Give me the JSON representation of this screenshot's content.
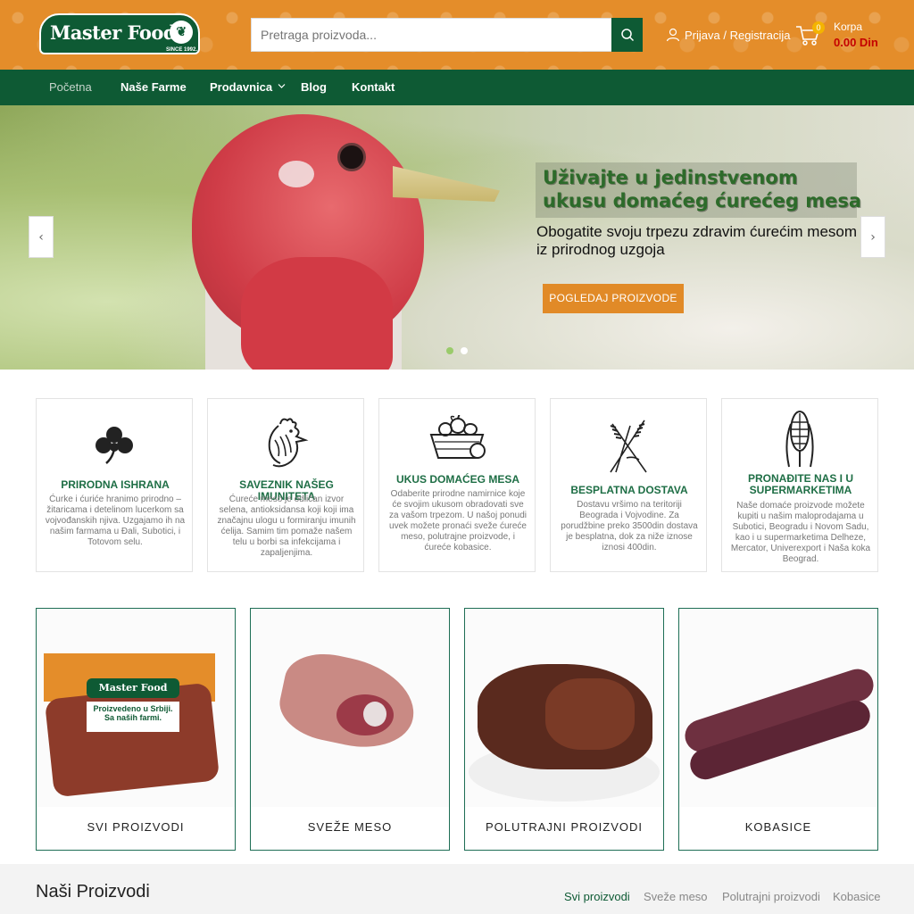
{
  "header": {
    "logo_text": "Master Food",
    "logo_tagline": "SINCE 1992.",
    "search_placeholder": "Pretraga proizvoda...",
    "account_label": "Prijava / Registracija",
    "cart_label": "Korpa",
    "cart_count": "0",
    "cart_total": "0.00 Din"
  },
  "nav": {
    "items": [
      "Početna",
      "Naše Farme",
      "Prodavnica",
      "Blog",
      "Kontakt"
    ]
  },
  "hero": {
    "title": "Uživajte u jedinstvenom ukusu domaćeg ćurećeg mesa",
    "subtitle": "Obogatite svoju trpezu zdravim ćurećim mesom iz prirodnog uzgoja",
    "cta": "POGLEDAJ PROIZVODE",
    "active_slide": 2,
    "slide_count": 2
  },
  "features": [
    {
      "icon": "clover-icon",
      "title": "PRIRODNA ISHRANA",
      "text": "Ćurke i ćuriće hranimo prirodno – žitaricama i detelinom lucerkom sa vojvođanskih njiva. Uzgajamo ih na našim farmama u Đali, Subotici, i Totovom selu."
    },
    {
      "icon": "rooster-icon",
      "title": "SAVEZNIK NAŠEG IMUNITETA",
      "text": "Ćureće meso je odličan izvor selena, antioksidansa koji koji ima značajnu ulogu u formiranju imunih ćelija. Samim tim pomaže našem telu u borbi sa infekcijama i zapaljenjima."
    },
    {
      "icon": "food-basket-icon",
      "title": "UKUS DOMAĆEG MESA",
      "text": "Odaberite prirodne namirnice koje će svojim ukusom obradovati sve za vašom trpezom. U našoj ponudi uvek možete pronaći sveže ćureće meso, polutrajne proizvode, i ćureće kobasice."
    },
    {
      "icon": "wheat-icon",
      "title": "BESPLATNA DOSTAVA",
      "text": "Dostavu vršimo na teritoriji Beograda i Vojvodine. Za porudžbine preko 3500din dostava je besplatna, dok za niže iznose iznosi 400din."
    },
    {
      "icon": "corn-icon",
      "title": "PRONAĐITE NAS I U SUPERMARKETIMA",
      "text": "Naše domaće proizvode možete kupiti u našim maloprodajama u Subotici, Beogradu i Novom Sadu, kao i u supermarketima Delheze, Mercator, Univerexport i Naša koka Beograd."
    }
  ],
  "categories": [
    {
      "label": "SVI PROIZVODI",
      "pack_brand": "Master Food",
      "pack_line1": "Proizvedeno u Srbiji.",
      "pack_line2": "Sa naših farmi."
    },
    {
      "label": "SVEŽE MESO"
    },
    {
      "label": "POLUTRAJNI PROIZVODI"
    },
    {
      "label": "KOBASICE"
    }
  ],
  "products_section": {
    "title": "Naši Proizvodi",
    "tabs": [
      "Svi proizvodi",
      "Sveže meso",
      "Polutrajni proizvodi",
      "Kobasice"
    ],
    "active_tab": "Svi proizvodi"
  },
  "colors": {
    "brand_green": "#0e5a34",
    "brand_orange": "#e48d2a",
    "price_red": "#c40000"
  }
}
